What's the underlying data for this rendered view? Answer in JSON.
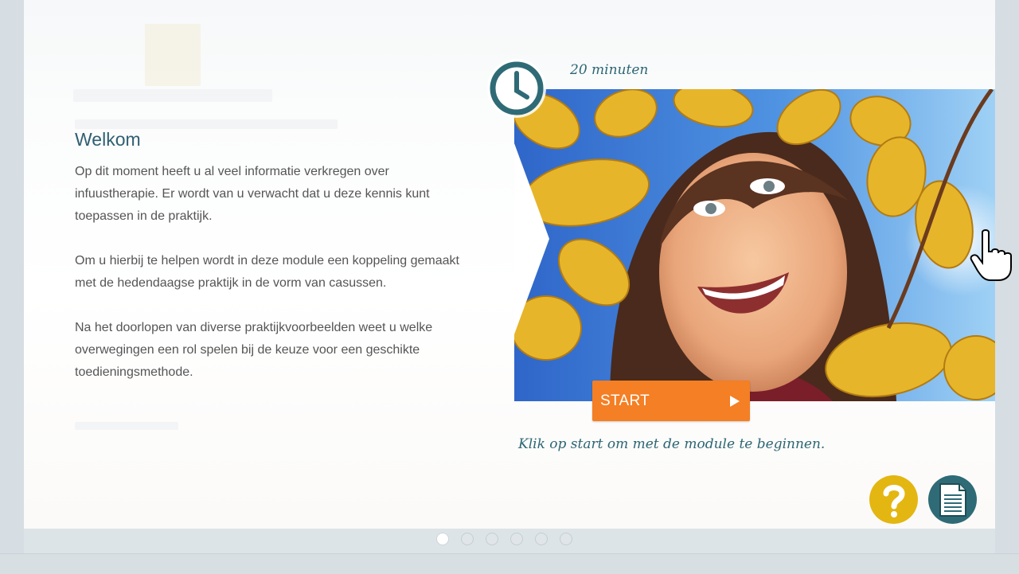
{
  "intro": {
    "title": "Welkom",
    "paragraphs": [
      "Op dit moment heeft u al veel informatie verkregen over infuustherapie. Er wordt van u verwacht dat u deze kennis kunt toepassen in de praktijk.",
      "Om u hierbij te helpen wordt in deze module een koppeling gemaakt met de hedendaagse praktijk in de vorm van casussen.",
      "Na het doorlopen van diverse praktijkvoorbeelden weet u welke overwegingen een rol spelen bij de keuze voor een geschikte toedieningsmethode."
    ]
  },
  "module": {
    "duration": "20 minuten",
    "clock_icon": "clock-icon",
    "start_label": "START",
    "start_icon": "play-arrow-icon",
    "instruction": "Klik op start om met de module te beginnen."
  },
  "actions": {
    "help_icon": "question-mark-icon",
    "document_icon": "document-icon"
  },
  "pager": {
    "total": 6,
    "current": 1
  },
  "colors": {
    "teal": "#2e6b76",
    "orange": "#f47f24",
    "yellow": "#e3b611",
    "title": "#2f5f73",
    "body_text": "#555555"
  }
}
